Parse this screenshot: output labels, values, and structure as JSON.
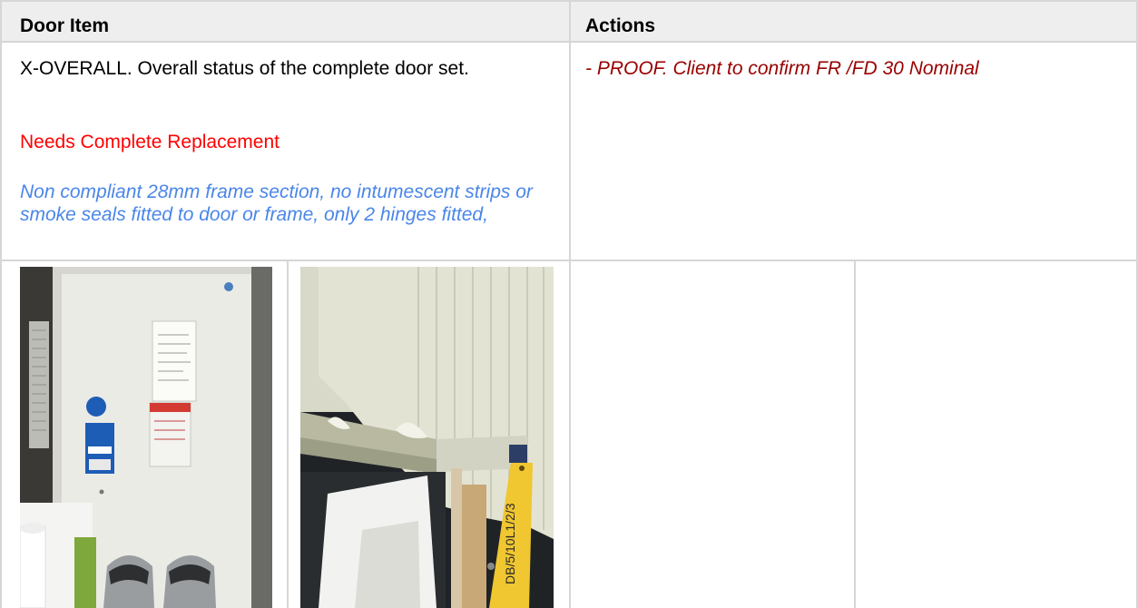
{
  "table": {
    "headers": {
      "door_item": "Door Item",
      "actions": "Actions"
    },
    "row": {
      "item_title": "X-OVERALL. Overall status of the complete door set.",
      "status": "Needs Complete Replacement",
      "note": "Non compliant 28mm frame section, no intumescent strips or smoke seals fitted to door or frame, only 2 hinges fitted,",
      "action": "- PROOF. Client to confirm FR /FD 30 Nominal"
    }
  },
  "photos": {
    "photo_1": {
      "tag_text": ""
    },
    "photo_2": {
      "tag_text": "DB/5/10L1/2/3"
    }
  },
  "colors": {
    "status_red": "#ff0000",
    "note_blue": "#4a86e8",
    "action_darkred": "#990000"
  }
}
